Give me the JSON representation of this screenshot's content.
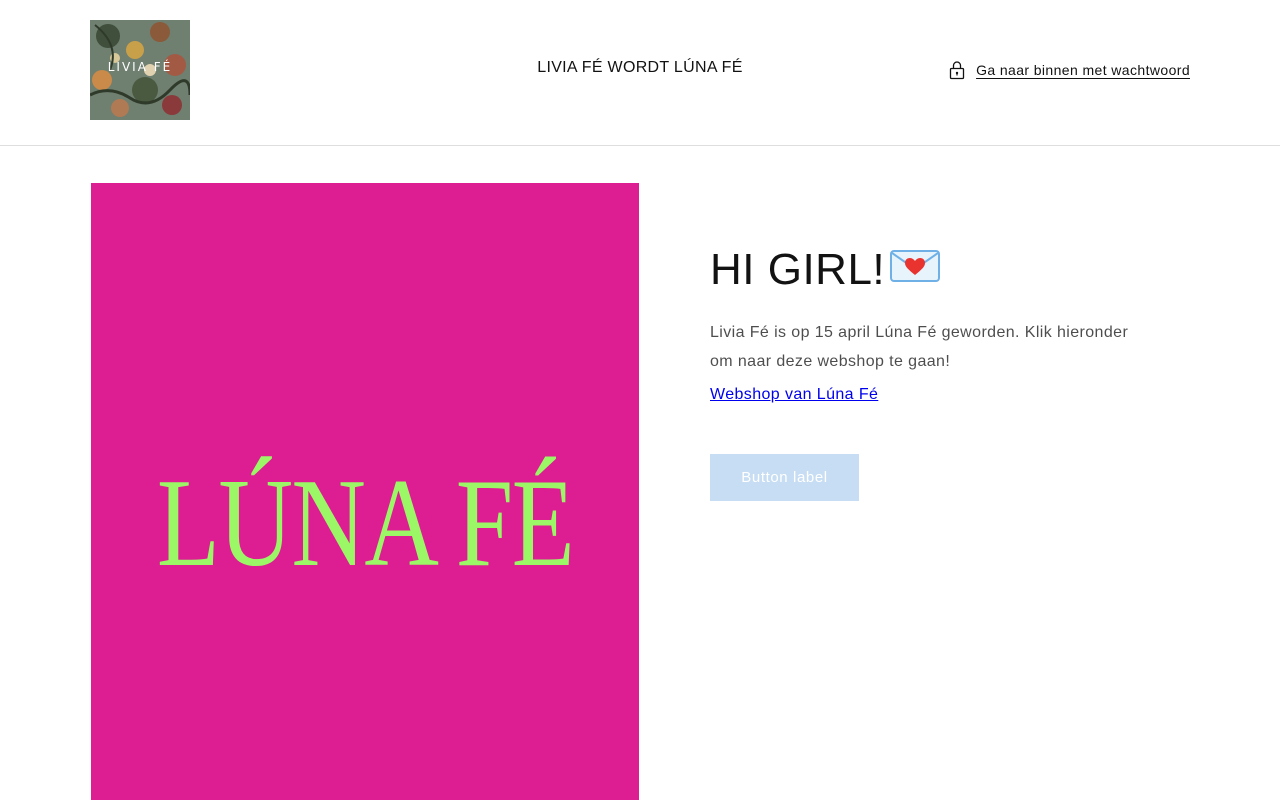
{
  "header": {
    "logo_text": "LIVIA FÉ",
    "title": "LIVIA FÉ WORDT LÚNA FÉ",
    "password_link_label": "Ga naar binnen met wachtwoord",
    "password_icon": "lock-icon"
  },
  "hero": {
    "brand_text": "LÚNA FÉ",
    "background_color": "#dc1e92",
    "text_color": "#9cf767"
  },
  "content": {
    "heading": "HI GIRL!",
    "heading_icon": "love-letter-icon",
    "body": "Livia Fé is op 15 april Lúna Fé geworden. Klik hieronder om naar deze webshop te gaan!",
    "link_label": "Webshop van Lúna Fé",
    "button_label": "Button label",
    "button_color": "#c6ddf3"
  }
}
